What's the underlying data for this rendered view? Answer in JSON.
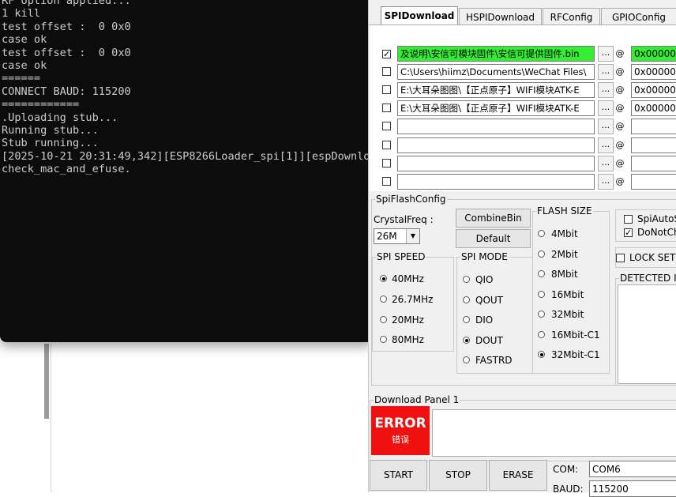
{
  "console": {
    "lines": [
      "RF option applied...",
      "1 kill",
      "test offset :  0 0x0",
      "case ok",
      "test offset :  0 0x0",
      "case ok",
      "======",
      "CONNECT BAUD: 115200",
      "============",
      ".Uploading stub...",
      "Running stub...",
      "Stub running...",
      "[2025-10-21 20:31:49,342][ESP8266Loader_spi[1]][espDownlo",
      "check_mac_and_efuse."
    ]
  },
  "tool": {
    "tabs": [
      "SPIDownload",
      "HSPIDownload",
      "RFConfig",
      "GPIOConfig"
    ],
    "active_tab": "SPIDownload",
    "files": [
      {
        "checked": true,
        "path": "及说明\\安信可模块固件\\安信可提供固件.bin",
        "addr": "0x00000",
        "highlight": true
      },
      {
        "checked": false,
        "path": "C:\\Users\\hiimz\\Documents\\WeChat Files\\",
        "addr": "0x00000",
        "highlight": false
      },
      {
        "checked": false,
        "path": "E:\\大耳朵图图\\【正点原子】WIFI模块ATK-E",
        "addr": "0x00000",
        "highlight": false
      },
      {
        "checked": false,
        "path": "E:\\大耳朵图图\\【正点原子】WIFI模块ATK-E",
        "addr": "0x00000",
        "highlight": false
      },
      {
        "checked": false,
        "path": "",
        "addr": "",
        "highlight": false
      },
      {
        "checked": false,
        "path": "",
        "addr": "",
        "highlight": false
      },
      {
        "checked": false,
        "path": "",
        "addr": "",
        "highlight": false
      },
      {
        "checked": false,
        "path": "",
        "addr": "",
        "highlight": false
      }
    ],
    "browse_label": "...",
    "at_label": "@",
    "spi_flash_config": {
      "title": "SpiFlashConfig",
      "crystal_label": "CrystalFreq :",
      "crystal_value": "26M",
      "combine_bin": "CombineBin",
      "default": "Default",
      "spi_speed": {
        "title": "SPI SPEED",
        "options": [
          "40MHz",
          "26.7MHz",
          "20MHz",
          "80MHz"
        ],
        "selected": "40MHz"
      },
      "spi_mode": {
        "title": "SPI MODE",
        "options": [
          "QIO",
          "QOUT",
          "DIO",
          "DOUT",
          "FASTRD"
        ],
        "selected": "DOUT"
      },
      "flash_size": {
        "title": "FLASH SIZE",
        "options": [
          "4Mbit",
          "2Mbit",
          "8Mbit",
          "16Mbit",
          "32Mbit",
          "16Mbit-C1",
          "32Mbit-C1"
        ],
        "selected": "32Mbit-C1"
      },
      "spi_auto": "SpiAutoS",
      "do_not_chg": "DoNotCh",
      "lock_settings": "LOCK SET",
      "detected_info": "DETECTED I"
    },
    "download_panel": {
      "title": "Download Panel 1",
      "status_en": "ERROR",
      "status_zh": "错误",
      "status_color": "#f01010"
    },
    "buttons": {
      "start": "START",
      "stop": "STOP",
      "erase": "ERASE"
    },
    "com": {
      "label": "COM:",
      "value": "COM6"
    },
    "baud": {
      "label": "BAUD:",
      "value": "115200"
    }
  }
}
